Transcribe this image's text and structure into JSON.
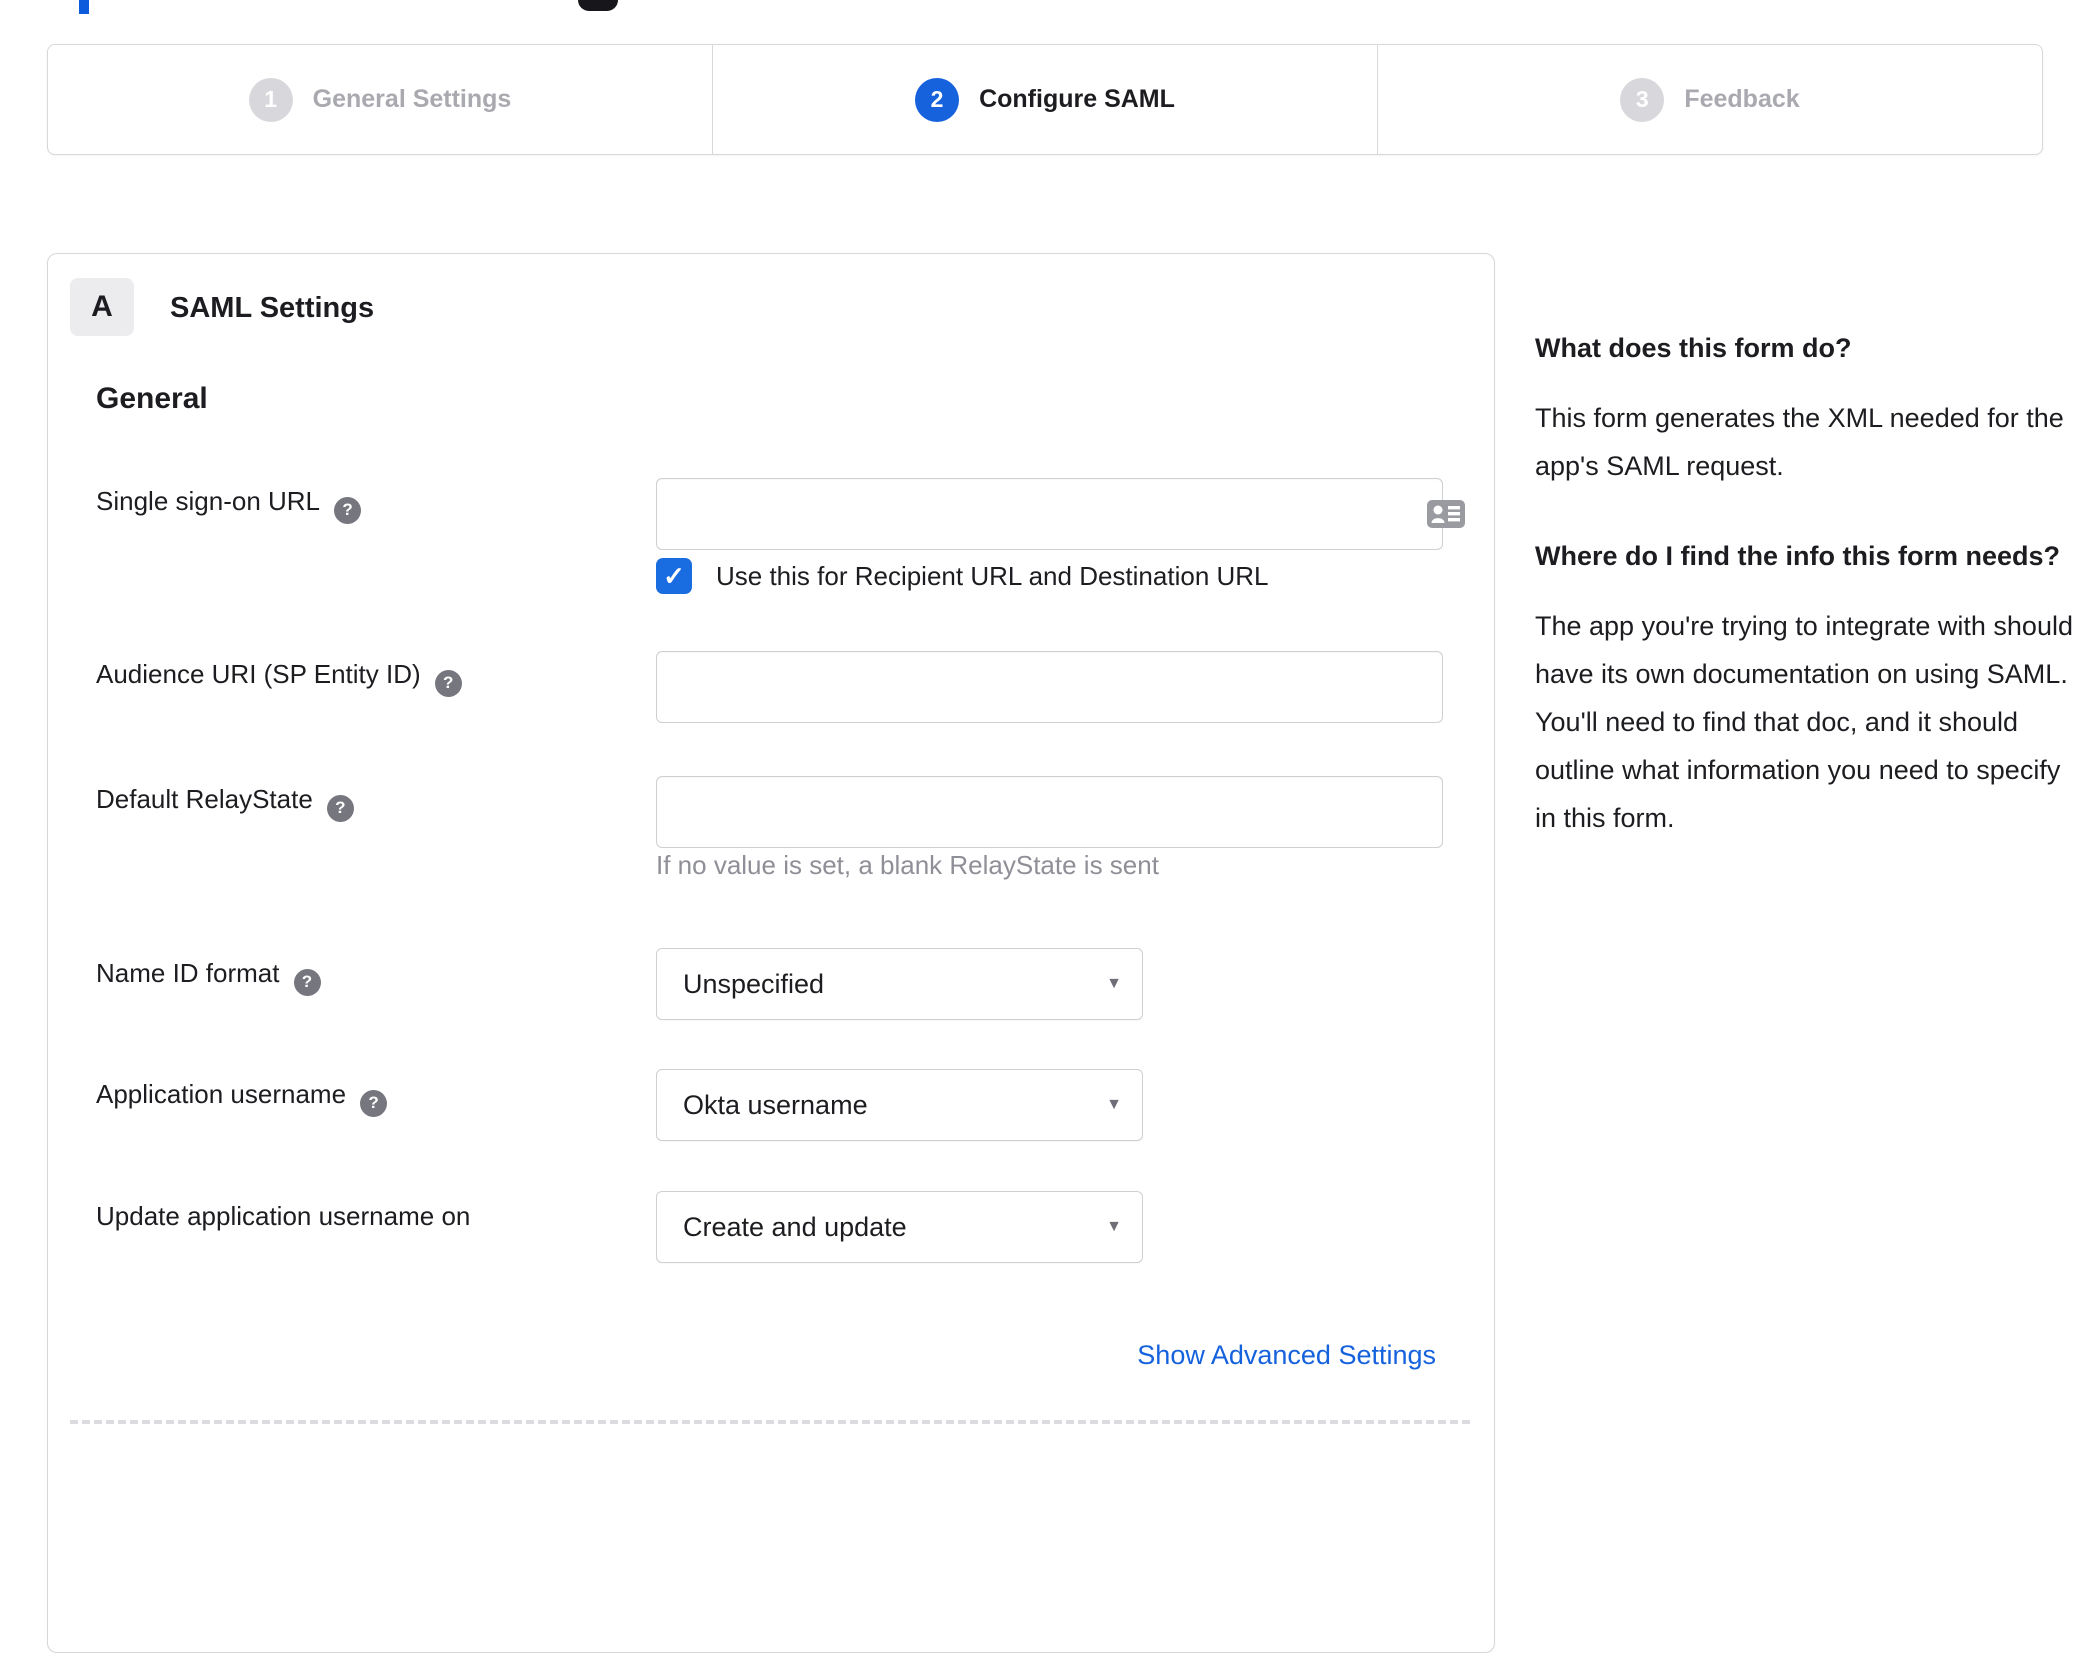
{
  "wizard": {
    "steps": [
      {
        "number": "1",
        "label": "General Settings",
        "state": "inactive"
      },
      {
        "number": "2",
        "label": "Configure SAML",
        "state": "active"
      },
      {
        "number": "3",
        "label": "Feedback",
        "state": "inactive"
      }
    ]
  },
  "panel": {
    "section_badge": "A",
    "section_title": "SAML Settings",
    "group_title": "General",
    "fields": [
      {
        "label": "Single sign-on URL",
        "type": "text",
        "value": "",
        "checkbox_checked": true,
        "checkbox_label": "Use this for Recipient URL and Destination URL"
      },
      {
        "label": "Audience URI (SP Entity ID)",
        "type": "text",
        "value": ""
      },
      {
        "label": "Default RelayState",
        "type": "text",
        "value": "",
        "helper": "If no value is set, a blank RelayState is sent"
      },
      {
        "label": "Name ID format",
        "type": "select",
        "value": "Unspecified"
      },
      {
        "label": "Application username",
        "type": "select",
        "value": "Okta username"
      },
      {
        "label": "Update application username on",
        "type": "select",
        "value": "Create and update"
      }
    ],
    "advanced_link": "Show Advanced Settings"
  },
  "sidebar": {
    "blocks": [
      {
        "heading": "What does this form do?",
        "body": "This form generates the XML needed for the app's SAML request."
      },
      {
        "heading": "Where do I find the info this form needs?",
        "body": "The app you're trying to integrate with should have its own documentation on using SAML. You'll need to find that doc, and it should outline what information you need to specify in this form."
      }
    ]
  },
  "icons": {
    "help_glyph": "?",
    "check_glyph": "✓",
    "dropdown_glyph": "▼"
  },
  "colors": {
    "accent_blue": "#1662dd",
    "checkbox_blue": "#1a6ce1",
    "link_blue": "#1662dd",
    "inactive_circle": "#d8d8dc",
    "inactive_label": "#a9a9b0",
    "border": "#d7d7dc",
    "text": "#1d1d21",
    "helper_text": "#8f8f97",
    "help_icon_bg": "#76767e",
    "badge_bg": "#ececee"
  }
}
